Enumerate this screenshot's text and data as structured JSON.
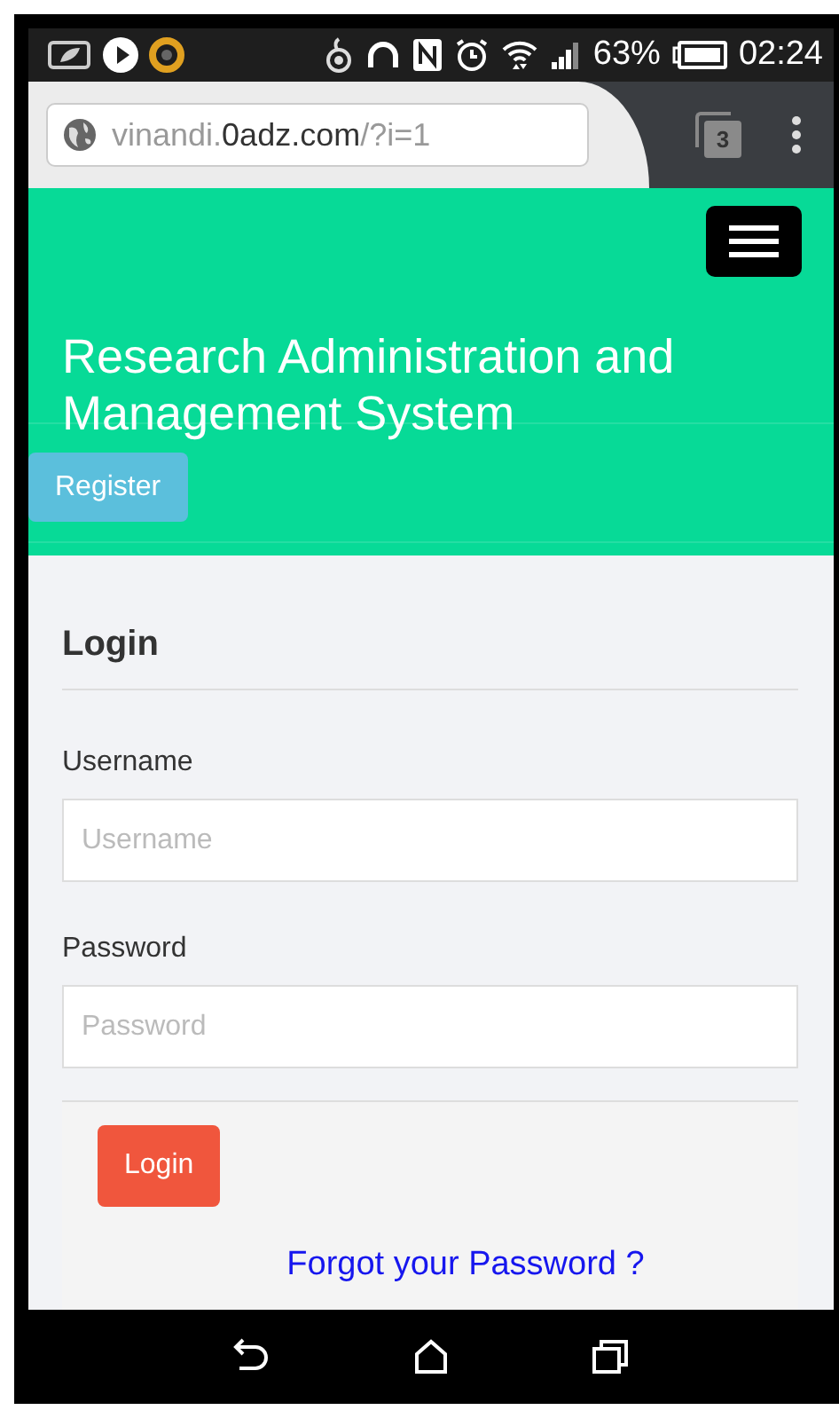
{
  "status_bar": {
    "battery": "63%",
    "time": "02:24"
  },
  "browser": {
    "url": {
      "prefix": "vinandi.",
      "domain": "0adz.com",
      "path": "/?i=1"
    },
    "tab_count": "3"
  },
  "header": {
    "title": "Research Administration and Management System",
    "register_button": "Register"
  },
  "login": {
    "heading": "Login",
    "fields": [
      {
        "label": "Username",
        "placeholder": "Username"
      },
      {
        "label": "Password",
        "placeholder": "Password"
      }
    ],
    "submit": "Login",
    "forgot_link": "Forgot your Password ?"
  }
}
